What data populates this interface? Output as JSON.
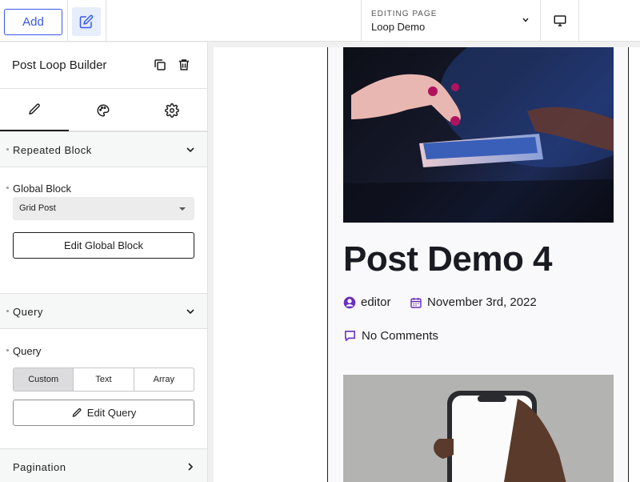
{
  "topbar": {
    "add_label": "Add",
    "editing_label": "EDITING PAGE",
    "editing_value": "Loop Demo"
  },
  "sidebar": {
    "title": "Post Loop Builder",
    "sections": {
      "repeated_block": "Repeated Block",
      "query": "Query",
      "pagination": "Pagination"
    },
    "global_block": {
      "label": "Global Block",
      "selected": "Grid Post",
      "edit_button": "Edit Global Block"
    },
    "query": {
      "label": "Query",
      "options": [
        "Custom",
        "Text",
        "Array"
      ],
      "selected": "Custom",
      "edit_button": "Edit Query"
    }
  },
  "preview": {
    "post_title": "Post Demo 4",
    "author": "editor",
    "date": "November 3rd, 2022",
    "comments": "No Comments"
  },
  "colors": {
    "accent": "#3858e9",
    "meta_icon": "#6b2fbf"
  }
}
